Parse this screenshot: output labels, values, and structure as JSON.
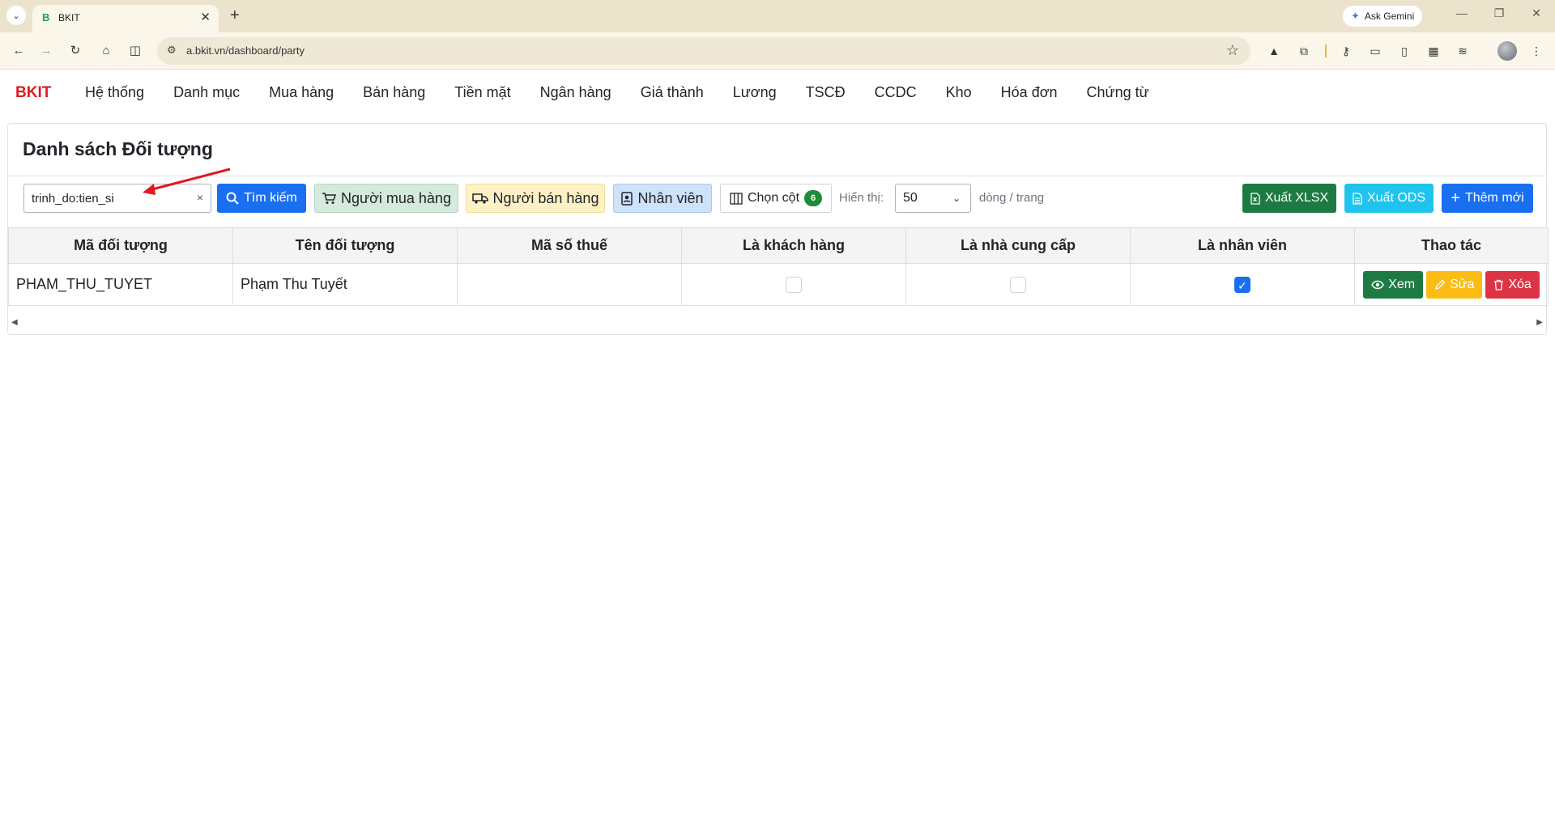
{
  "browser": {
    "tab_title": "BKIT",
    "tab_favicon": "B",
    "url": "a.bkit.vn/dashboard/party",
    "ask_gemini": "Ask Gemini"
  },
  "nav": {
    "brand": "BKIT",
    "items": [
      "Hệ thống",
      "Danh mục",
      "Mua hàng",
      "Bán hàng",
      "Tiền mặt",
      "Ngân hàng",
      "Giá thành",
      "Lương",
      "TSCĐ",
      "CCDC",
      "Kho",
      "Hóa đơn",
      "Chứng từ"
    ]
  },
  "page": {
    "title": "Danh sách Đối tượng",
    "search_value": "trinh_do:tien_si",
    "clear_symbol": "×",
    "search_button": "Tìm kiếm",
    "filter_buyer": "Người mua hàng",
    "filter_seller": "Người bán hàng",
    "filter_staff": "Nhân viên",
    "columns_button": "Chọn cột",
    "columns_count": "6",
    "show_label": "Hiển thị:",
    "page_size": "50",
    "per_page_label": "dòng / trang",
    "export_xlsx": "Xuất XLSX",
    "export_ods": "Xuất ODS",
    "add_new": "Thêm mới"
  },
  "table": {
    "headers": [
      "Mã đối tượng",
      "Tên đối tượng",
      "Mã số thuế",
      "Là khách hàng",
      "Là nhà cung cấp",
      "Là nhân viên",
      "Thao tác"
    ],
    "rows": [
      {
        "code": "PHAM_THU_TUYET",
        "name": "Phạm Thu Tuyết",
        "tax_code": "",
        "is_customer": false,
        "is_supplier": false,
        "is_employee": true,
        "actions": [
          "Xem",
          "Sửa",
          "Xóa"
        ]
      }
    ]
  },
  "colors": {
    "brand": "#e0191f",
    "primary": "#1a6ff1",
    "success": "#1e7a43",
    "warning": "#fbbd14",
    "danger": "#dc3445",
    "info": "#1fc4ec",
    "annotation_arrow": "#e0191f"
  }
}
